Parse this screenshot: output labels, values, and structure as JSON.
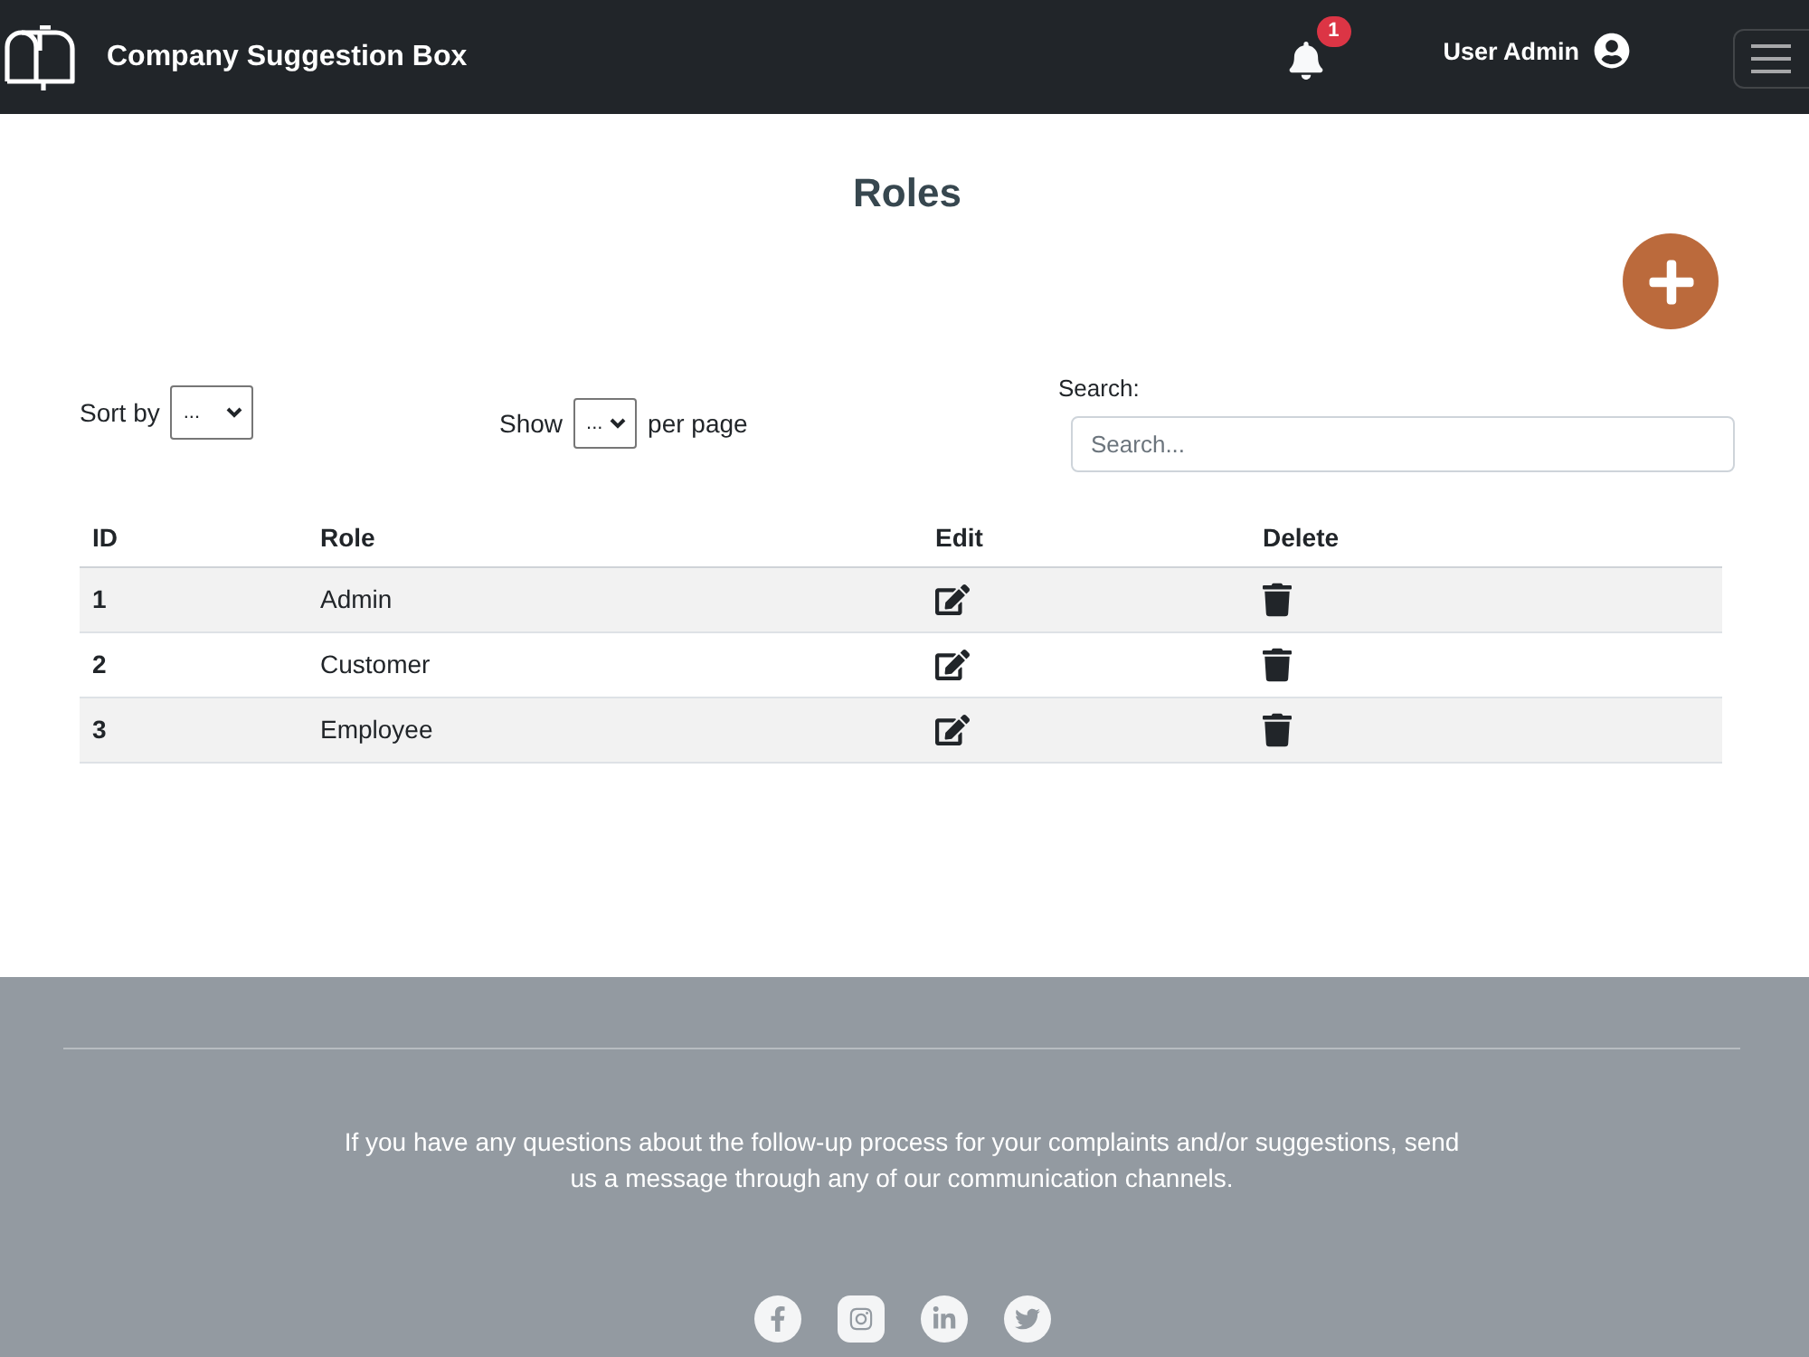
{
  "navbar": {
    "title": "Company Suggestion Box",
    "notification_count": "1",
    "user_name": "User Admin"
  },
  "page": {
    "title": "Roles"
  },
  "controls": {
    "sort_label": "Sort by",
    "sort_value": "...",
    "show_label": "Show",
    "show_value": "...",
    "per_page_label": "per page",
    "search_label": "Search:",
    "search_placeholder": "Search..."
  },
  "table": {
    "columns": [
      "ID",
      "Role",
      "Edit",
      "Delete"
    ],
    "rows": [
      {
        "id": "1",
        "role": "Admin"
      },
      {
        "id": "2",
        "role": "Customer"
      },
      {
        "id": "3",
        "role": "Employee"
      }
    ]
  },
  "footer": {
    "message": "If you have any questions about the follow-up process for your complaints and/or suggestions, send us a message through any of our communication channels."
  }
}
